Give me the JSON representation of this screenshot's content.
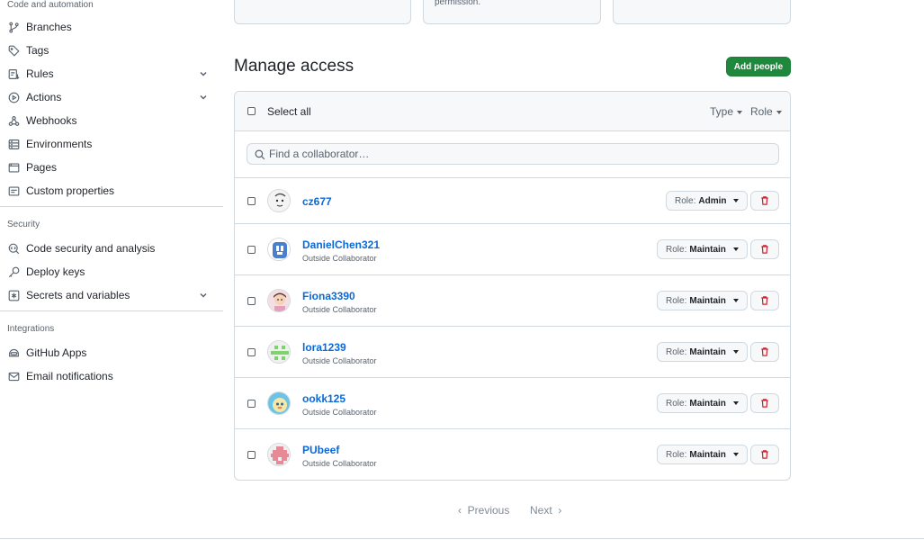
{
  "sidebar": {
    "code_heading": "Code and automation",
    "code_items": [
      {
        "label": "Branches",
        "icon": "git-branch-icon"
      },
      {
        "label": "Tags",
        "icon": "tag-icon"
      },
      {
        "label": "Rules",
        "icon": "rules-icon",
        "expandable": true
      },
      {
        "label": "Actions",
        "icon": "play-icon",
        "expandable": true
      },
      {
        "label": "Webhooks",
        "icon": "webhook-icon"
      },
      {
        "label": "Environments",
        "icon": "server-icon"
      },
      {
        "label": "Pages",
        "icon": "browser-icon"
      },
      {
        "label": "Custom properties",
        "icon": "note-icon"
      }
    ],
    "security_heading": "Security",
    "security_items": [
      {
        "label": "Code security and analysis",
        "icon": "codescan-icon"
      },
      {
        "label": "Deploy keys",
        "icon": "key-icon"
      },
      {
        "label": "Secrets and variables",
        "icon": "asterisk-icon",
        "expandable": true
      }
    ],
    "integrations_heading": "Integrations",
    "integrations_items": [
      {
        "label": "GitHub Apps",
        "icon": "hubot-icon"
      },
      {
        "label": "Email notifications",
        "icon": "mail-icon"
      }
    ]
  },
  "top_cards": [
    "",
    "permission.",
    ""
  ],
  "main": {
    "title": "Manage access",
    "add_button": "Add people",
    "select_all": "Select all",
    "filter_type": "Type",
    "filter_role": "Role",
    "search_placeholder": "Find a collaborator…",
    "role_prefix": "Role:",
    "collaborators": [
      {
        "name": "cz677",
        "subtitle": "",
        "role": "Admin"
      },
      {
        "name": "DanielChen321",
        "subtitle": "Outside Collaborator",
        "role": "Maintain"
      },
      {
        "name": "Fiona3390",
        "subtitle": "Outside Collaborator",
        "role": "Maintain"
      },
      {
        "name": "lora1239",
        "subtitle": "Outside Collaborator",
        "role": "Maintain"
      },
      {
        "name": "ookk125",
        "subtitle": "Outside Collaborator",
        "role": "Maintain"
      },
      {
        "name": "PUbeef",
        "subtitle": "Outside Collaborator",
        "role": "Maintain"
      }
    ]
  },
  "pagination": {
    "previous": "Previous",
    "next": "Next"
  },
  "colors": {
    "primary_button": "#1f883d",
    "link": "#0969da",
    "danger": "#cf222e"
  }
}
